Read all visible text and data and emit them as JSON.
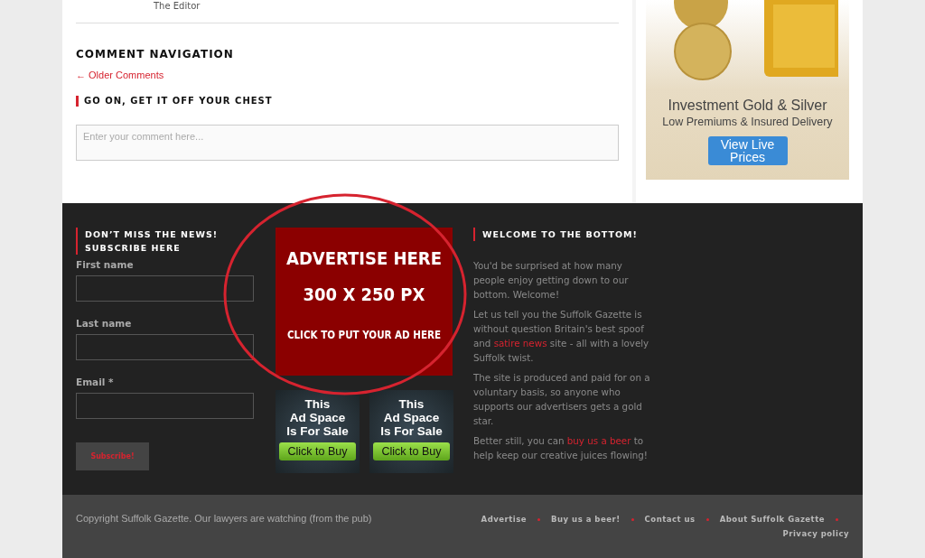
{
  "comment_author": "The Editor",
  "comment_navigation": {
    "heading": "COMMENT NAVIGATION",
    "older_link": "← Older Comments"
  },
  "reply": {
    "heading": "GO ON, GET IT OFF YOUR CHEST",
    "placeholder": "Enter your comment here..."
  },
  "sidebar_ad": {
    "headline": "Investment Gold & Silver",
    "subline": "Low Premiums & Insured Delivery",
    "button": "View Live Prices"
  },
  "footer": {
    "subscribe": {
      "heading_lines": [
        "DON’T MISS THE NEWS!",
        "SUBSCRIBE HERE"
      ],
      "fields": [
        {
          "label": "First name"
        },
        {
          "label": "Last name"
        },
        {
          "label": "Email *"
        }
      ],
      "button": "Subscribe!"
    },
    "main_ad": {
      "lines": [
        "ADVERTISE HERE",
        "300 X 250 PX",
        "CLICK TO PUT YOUR AD HERE"
      ]
    },
    "small_ads": [
      {
        "lines": [
          "This",
          "Ad Space",
          "Is For Sale"
        ],
        "button": "Click to Buy"
      },
      {
        "lines": [
          "This",
          "Ad Space",
          "Is For Sale"
        ],
        "button": "Click to Buy"
      }
    ],
    "welcome": {
      "heading": "WELCOME TO THE BOTTOM!",
      "paragraphs": [
        [
          {
            "kind": "text",
            "text": "You'd be surprised at how many people enjoy getting down to our bottom. Welcome!"
          }
        ],
        [
          {
            "kind": "text",
            "text": "Let us tell you the Suffolk Gazette is without question Britain's best spoof and "
          },
          {
            "kind": "link",
            "text": "satire news"
          },
          {
            "kind": "text",
            "text": " site - all with a lovely Suffolk twist."
          }
        ],
        [
          {
            "kind": "text",
            "text": "The site is produced and paid for on a voluntary basis, so anyone who supports our advertisers gets a gold star."
          }
        ],
        [
          {
            "kind": "text",
            "text": "Better still, you can "
          },
          {
            "kind": "link",
            "text": "buy us a beer"
          },
          {
            "kind": "text",
            "text": " to help keep our creative juices flowing!"
          }
        ]
      ]
    }
  },
  "bottom_bar": {
    "copyright": "Copyright Suffolk Gazette. Our lawyers are watching (from the pub)",
    "links": [
      "Advertise",
      "Buy us a beer!",
      "Contact us",
      "About Suffolk Gazette",
      "Privacy policy"
    ]
  }
}
